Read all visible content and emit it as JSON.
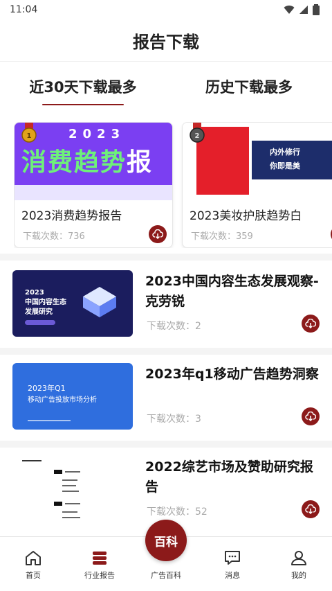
{
  "status_bar": {
    "time": "11:04"
  },
  "header": {
    "title": "报告下载"
  },
  "tabs": [
    {
      "label": "近30天下载最多",
      "active": true
    },
    {
      "label": "历史下载最多",
      "active": false
    }
  ],
  "top_cards": [
    {
      "title": "2023消费趋势报告",
      "downloads": "下载次数：736",
      "thumb_year": "2023",
      "thumb_text_green": "消费趋势",
      "thumb_text_white": "报告"
    },
    {
      "title": "2023美妆护肤趋势白",
      "downloads": "下载次数：359",
      "thumb_line1": "内外修行",
      "thumb_line2": "你即是美"
    }
  ],
  "list_items": [
    {
      "title": "2023中国内容生态发展观察-克劳锐",
      "downloads": "下载次数：2",
      "thumb_text": "2023\n中国内容生态\n发展研究"
    },
    {
      "title": "2023年q1移动广告趋势洞察",
      "downloads": "下载次数：3",
      "thumb_line1": "2023年Q1",
      "thumb_line2": "移动广告投放市场分析"
    },
    {
      "title": "2022综艺市场及赞助研究报告",
      "downloads": "下载次数：52"
    }
  ],
  "bottom_nav": {
    "items": [
      {
        "label": "首页"
      },
      {
        "label": "行业报告"
      },
      {
        "label": "消息"
      },
      {
        "label": "我的"
      }
    ],
    "center_button": "百科",
    "center_label": "广告百科"
  },
  "colors": {
    "accent": "#8c1a1a",
    "muted_text": "#aaaaaa"
  }
}
